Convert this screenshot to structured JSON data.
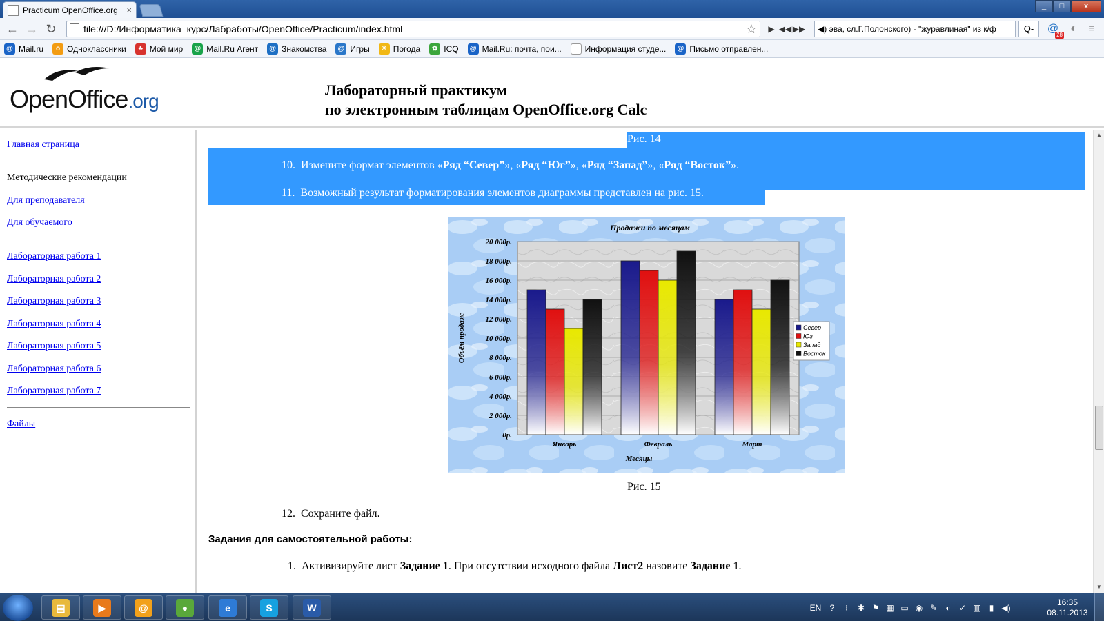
{
  "browser": {
    "tab_title": "Practicum OpenOffice.org",
    "tab_close": "×",
    "url": "file:///D:/Информатика_курс/Лабработы/OpenOffice/Practicum/index.html",
    "now_playing": "эва, сл.Г.Полонского) - \"журавлиная\" из к/ф",
    "search_label": "Q-",
    "ext_badge": "28",
    "bookmarks": [
      {
        "label": "Mail.ru",
        "icon": "mailru-icon",
        "color": "#1a64c7"
      },
      {
        "label": "Одноклассники",
        "icon": "odnoklassniki-icon",
        "color": "#f39c12"
      },
      {
        "label": "Мой мир",
        "icon": "moy-mir-icon",
        "color": "#d7322d"
      },
      {
        "label": "Mail.Ru Агент",
        "icon": "agent-icon",
        "color": "#19a34a"
      },
      {
        "label": "Знакомства",
        "icon": "at-icon",
        "color": "#1d6fc4"
      },
      {
        "label": "Игры",
        "icon": "games-icon",
        "color": "#2a77c9"
      },
      {
        "label": "Погода",
        "icon": "weather-icon",
        "color": "#f1b816"
      },
      {
        "label": "ICQ",
        "icon": "icq-icon",
        "color": "#3ca63c"
      },
      {
        "label": "Mail.Ru: почта, пои...",
        "icon": "mailru-icon",
        "color": "#1a64c7"
      },
      {
        "label": "Информация студе...",
        "icon": "page-icon",
        "color": "#ffffff"
      },
      {
        "label": "Письмо отправлен...",
        "icon": "mailru-icon",
        "color": "#1a64c7"
      }
    ]
  },
  "header": {
    "logo_main": "OpenOffice",
    "logo_suffix": ".org",
    "title_line1": "Лабораторный практикум",
    "title_line2": "по электронным таблицам OpenOffice.org Calc"
  },
  "sidebar": {
    "home": "Главная страница",
    "methodical": "Методические рекомендации",
    "for_teacher": "Для преподавателя",
    "for_student": "Для обучаемого",
    "labs": [
      "Лабораторная работа 1",
      "Лабораторная работа 2",
      "Лабораторная работа 3",
      "Лабораторная работа 4",
      "Лабораторная работа 5",
      "Лабораторная работа 6",
      "Лабораторная работа 7"
    ],
    "files": "Файлы"
  },
  "content": {
    "fig14": "Рис. 14",
    "step10_num": "10.",
    "step10_a": "Измените формат элементов «",
    "step10_b": "Ряд “Север”",
    "step10_c": "», «",
    "step10_d": "Ряд “Юг”",
    "step10_e": "», «",
    "step10_f": "Ряд “Запад”",
    "step10_g": "», «",
    "step10_h": "Ряд “Восток”",
    "step10_i": "».",
    "step11_num": "11.",
    "step11": "Возможный результат форматирования элементов диаграммы представлен на рис. 15.",
    "fig15": "Рис. 15",
    "step12_num": "12.",
    "step12": "Сохраните файл.",
    "tasks_heading": "Задания для самостоятельной работы:",
    "task1_num": "1.",
    "task1_a": "Активизируйте лист ",
    "task1_b": "Задание 1",
    "task1_c": ". При отсутствии исходного файла ",
    "task1_d": "Лист2",
    "task1_e": " назовите ",
    "task1_f": "Задание 1",
    "task1_g": "."
  },
  "chart_data": {
    "type": "bar",
    "title": "Продажи по месяцам",
    "xlabel": "Месяцы",
    "ylabel": "Объём продаж",
    "categories": [
      "Январь",
      "Февраль",
      "Март"
    ],
    "series": [
      {
        "name": "Север",
        "values": [
          15000,
          18000,
          14000
        ],
        "color": "#1a1a8c"
      },
      {
        "name": "Юг",
        "values": [
          13000,
          17000,
          15000
        ],
        "color": "#e01010"
      },
      {
        "name": "Запад",
        "values": [
          11000,
          16000,
          13000
        ],
        "color": "#e8e800"
      },
      {
        "name": "Восток",
        "values": [
          14000,
          19000,
          16000
        ],
        "color": "#111111"
      }
    ],
    "ylim": [
      0,
      20000
    ],
    "yticks": [
      0,
      2000,
      4000,
      6000,
      8000,
      10000,
      12000,
      14000,
      16000,
      18000,
      20000
    ],
    "ytick_labels": [
      "0р.",
      "2 000р.",
      "4 000р.",
      "6 000р.",
      "8 000р.",
      "10 000р.",
      "12 000р.",
      "14 000р.",
      "16 000р.",
      "18 000р.",
      "20 000р."
    ],
    "grid": true,
    "legend": "right"
  },
  "taskbar": {
    "lang": "EN",
    "time": "16:35",
    "date": "08.11.2013",
    "apps": [
      {
        "name": "explorer-icon",
        "glyph": "▤",
        "color": "#e8b93c"
      },
      {
        "name": "media-player-icon",
        "glyph": "▶",
        "color": "#e87a1c"
      },
      {
        "name": "mail-agent-icon",
        "glyph": "@",
        "color": "#f2a11b"
      },
      {
        "name": "chrome-icon",
        "glyph": "●",
        "color": "#5aa83a"
      },
      {
        "name": "internet-explorer-icon",
        "glyph": "e",
        "color": "#2e7bd6"
      },
      {
        "name": "skype-icon",
        "glyph": "S",
        "color": "#16a1e0"
      },
      {
        "name": "word-icon",
        "glyph": "W",
        "color": "#2a5ba8"
      }
    ]
  }
}
